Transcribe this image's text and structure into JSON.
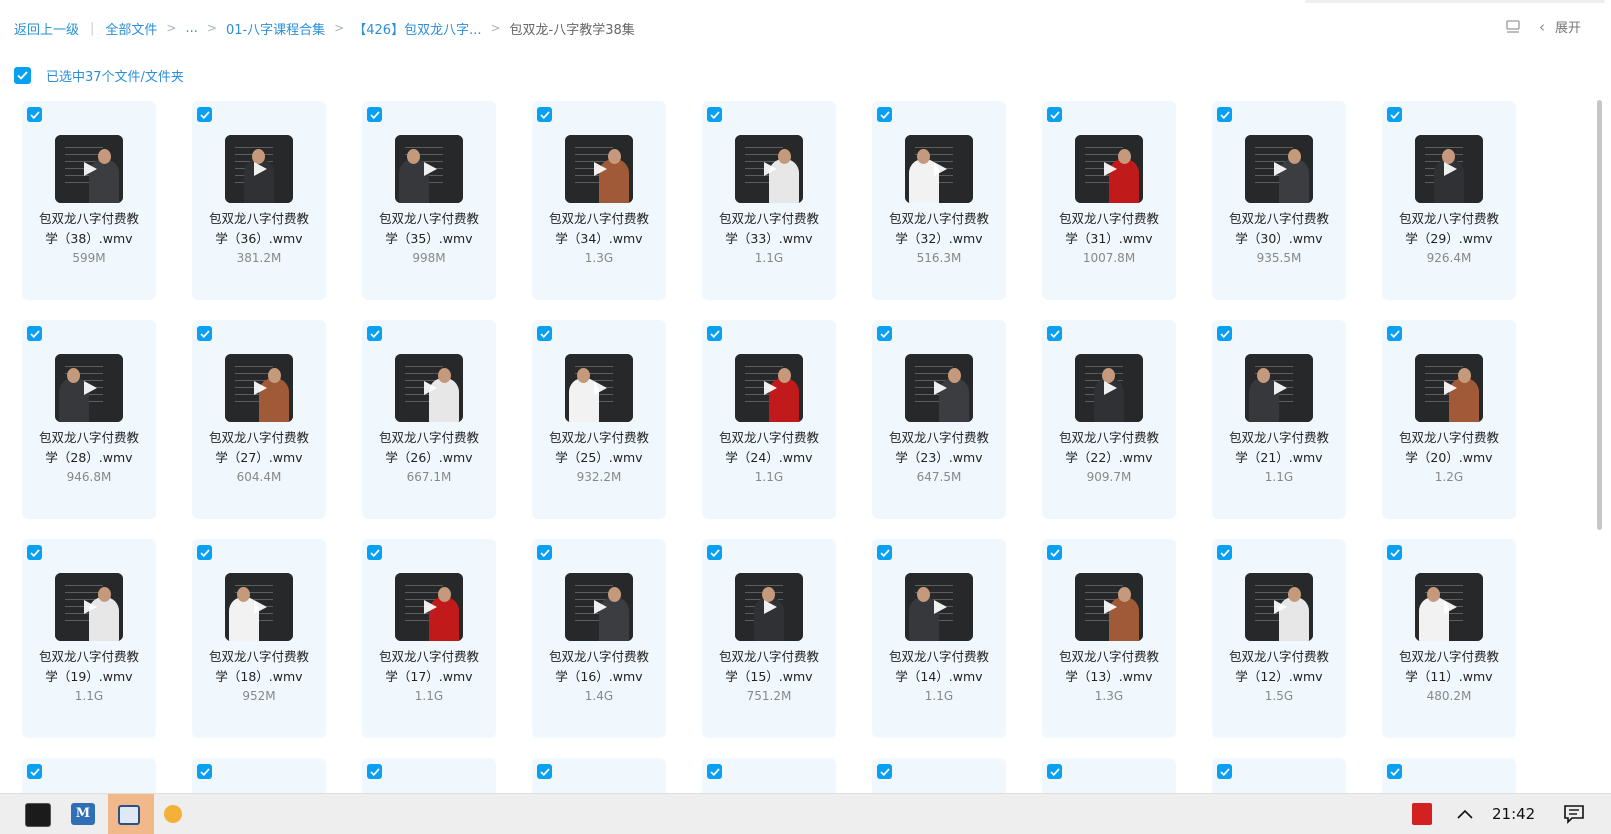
{
  "breadcrumb": {
    "back": "返回上一级",
    "all_files": "全部文件",
    "ellipsis": "...",
    "level1": "01-八字课程合集",
    "level2": "【426】包双龙八字...",
    "current": "包双龙-八字教学38集"
  },
  "toolbar": {
    "expand": "展开"
  },
  "selection": {
    "label": "已选中37个文件/文件夹"
  },
  "files": [
    {
      "line1": "包双龙八字付费教",
      "line2": "学（38）.wmv",
      "size": "599M"
    },
    {
      "line1": "包双龙八字付费教",
      "line2": "学（36）.wmv",
      "size": "381.2M"
    },
    {
      "line1": "包双龙八字付费教",
      "line2": "学（35）.wmv",
      "size": "998M"
    },
    {
      "line1": "包双龙八字付费教",
      "line2": "学（34）.wmv",
      "size": "1.3G"
    },
    {
      "line1": "包双龙八字付费教",
      "line2": "学（33）.wmv",
      "size": "1.1G"
    },
    {
      "line1": "包双龙八字付费教",
      "line2": "学（32）.wmv",
      "size": "516.3M"
    },
    {
      "line1": "包双龙八字付费教",
      "line2": "学（31）.wmv",
      "size": "1007.8M"
    },
    {
      "line1": "包双龙八字付费教",
      "line2": "学（30）.wmv",
      "size": "935.5M"
    },
    {
      "line1": "包双龙八字付费教",
      "line2": "学（29）.wmv",
      "size": "926.4M"
    },
    {
      "line1": "包双龙八字付费教",
      "line2": "学（28）.wmv",
      "size": "946.8M"
    },
    {
      "line1": "包双龙八字付费教",
      "line2": "学（27）.wmv",
      "size": "604.4M"
    },
    {
      "line1": "包双龙八字付费教",
      "line2": "学（26）.wmv",
      "size": "667.1M"
    },
    {
      "line1": "包双龙八字付费教",
      "line2": "学（25）.wmv",
      "size": "932.2M"
    },
    {
      "line1": "包双龙八字付费教",
      "line2": "学（24）.wmv",
      "size": "1.1G"
    },
    {
      "line1": "包双龙八字付费教",
      "line2": "学（23）.wmv",
      "size": "647.5M"
    },
    {
      "line1": "包双龙八字付费教",
      "line2": "学（22）.wmv",
      "size": "909.7M"
    },
    {
      "line1": "包双龙八字付费教",
      "line2": "学（21）.wmv",
      "size": "1.1G"
    },
    {
      "line1": "包双龙八字付费教",
      "line2": "学（20）.wmv",
      "size": "1.2G"
    },
    {
      "line1": "包双龙八字付费教",
      "line2": "学（19）.wmv",
      "size": "1.1G"
    },
    {
      "line1": "包双龙八字付费教",
      "line2": "学（18）.wmv",
      "size": "952M"
    },
    {
      "line1": "包双龙八字付费教",
      "line2": "学（17）.wmv",
      "size": "1.1G"
    },
    {
      "line1": "包双龙八字付费教",
      "line2": "学（16）.wmv",
      "size": "1.4G"
    },
    {
      "line1": "包双龙八字付费教",
      "line2": "学（15）.wmv",
      "size": "751.2M"
    },
    {
      "line1": "包双龙八字付费教",
      "line2": "学（14）.wmv",
      "size": "1.1G"
    },
    {
      "line1": "包双龙八字付费教",
      "line2": "学（13）.wmv",
      "size": "1.3G"
    },
    {
      "line1": "包双龙八字付费教",
      "line2": "学（12）.wmv",
      "size": "1.5G"
    },
    {
      "line1": "包双龙八字付费教",
      "line2": "学（11）.wmv",
      "size": "480.2M"
    }
  ],
  "partial_row_count": 9,
  "taskbar": {
    "time": "21:42"
  },
  "colors": {
    "accent": "#0aa0f2",
    "link": "#2a8fd8",
    "card_bg": "#f0f8fd"
  }
}
